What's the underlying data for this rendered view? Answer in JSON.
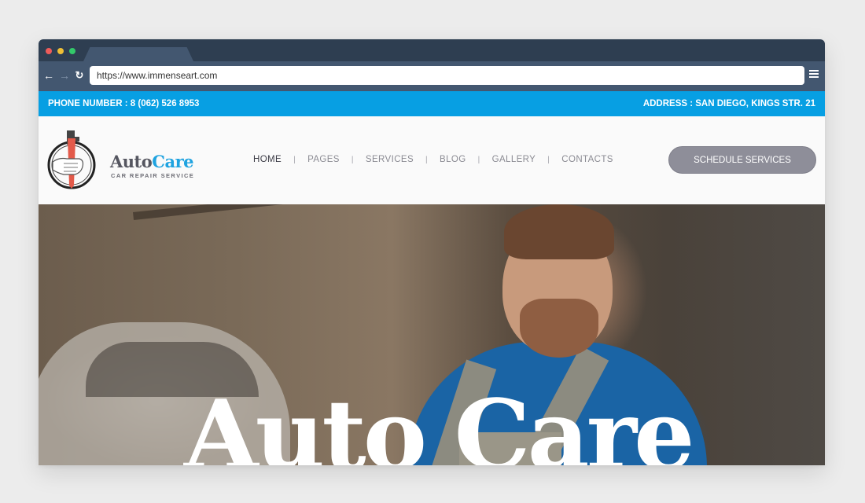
{
  "browser": {
    "url": "https://www.immenseart.com",
    "back_icon": "←",
    "forward_icon": "→",
    "reload_icon": "↻"
  },
  "infobar": {
    "phone": "PHONE NUMBER : 8 (062) 526 8953",
    "address": "ADDRESS : SAN DIEGO, KINGS STR. 21",
    "color": "#079fe3"
  },
  "logo": {
    "name_part1": "Auto",
    "name_part2": "Care",
    "tagline": "CAR REPAIR SERVICE"
  },
  "nav": {
    "items": [
      {
        "label": "HOME",
        "active": true
      },
      {
        "label": "PAGES"
      },
      {
        "label": "SERVICES"
      },
      {
        "label": "BLOG"
      },
      {
        "label": "GALLERY"
      },
      {
        "label": "CONTACTS"
      }
    ],
    "separator": "|"
  },
  "cta": {
    "label": "SCHEDULE SERVICES"
  },
  "hero": {
    "title": "Auto Care"
  }
}
